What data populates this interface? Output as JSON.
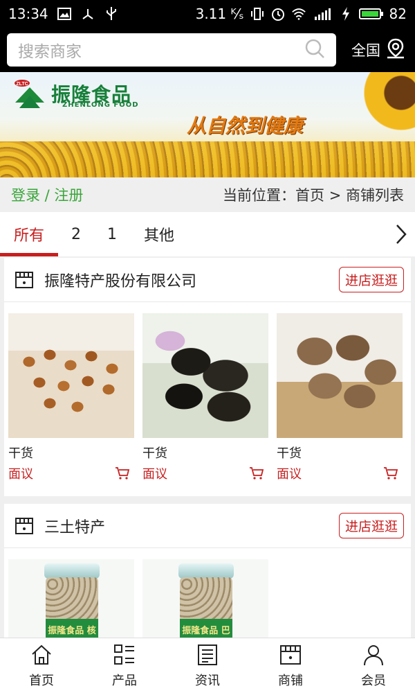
{
  "status_bar": {
    "time": "13:34",
    "speed": "3.11 ᴷ⁄ₛ",
    "network": "4G",
    "battery": "82"
  },
  "search": {
    "placeholder": "搜索商家",
    "region_label": "全国"
  },
  "banner": {
    "logo_text": "振隆食品",
    "logo_sub": "ZHENLONG FOOD",
    "logo_badge": "ZLTC",
    "slogan": "从自然到健康"
  },
  "breadcrumb": {
    "login": "登录 / 注册",
    "location": "当前位置：首页 > 商铺列表"
  },
  "tabs": [
    {
      "label": "所有",
      "active": true
    },
    {
      "label": "2",
      "active": false
    },
    {
      "label": "1",
      "active": false
    },
    {
      "label": "其他",
      "active": false
    }
  ],
  "stores": [
    {
      "name": "振隆特产股份有限公司",
      "enter_label": "进店逛逛",
      "products": [
        {
          "name": "干货",
          "price": "面议"
        },
        {
          "name": "干货",
          "price": "面议"
        },
        {
          "name": "干货",
          "price": "面议"
        }
      ]
    },
    {
      "name": "三土特产",
      "enter_label": "进店逛逛",
      "products": [
        {
          "label": "振隆食品 核桃仁"
        },
        {
          "label": "振隆食品 巴旦木（扁桃核）"
        }
      ]
    }
  ],
  "bottom_nav": [
    {
      "label": "首页",
      "icon": "home-icon"
    },
    {
      "label": "产品",
      "icon": "grid-icon"
    },
    {
      "label": "资讯",
      "icon": "news-icon"
    },
    {
      "label": "商铺",
      "icon": "shop-icon"
    },
    {
      "label": "会员",
      "icon": "user-icon"
    }
  ]
}
